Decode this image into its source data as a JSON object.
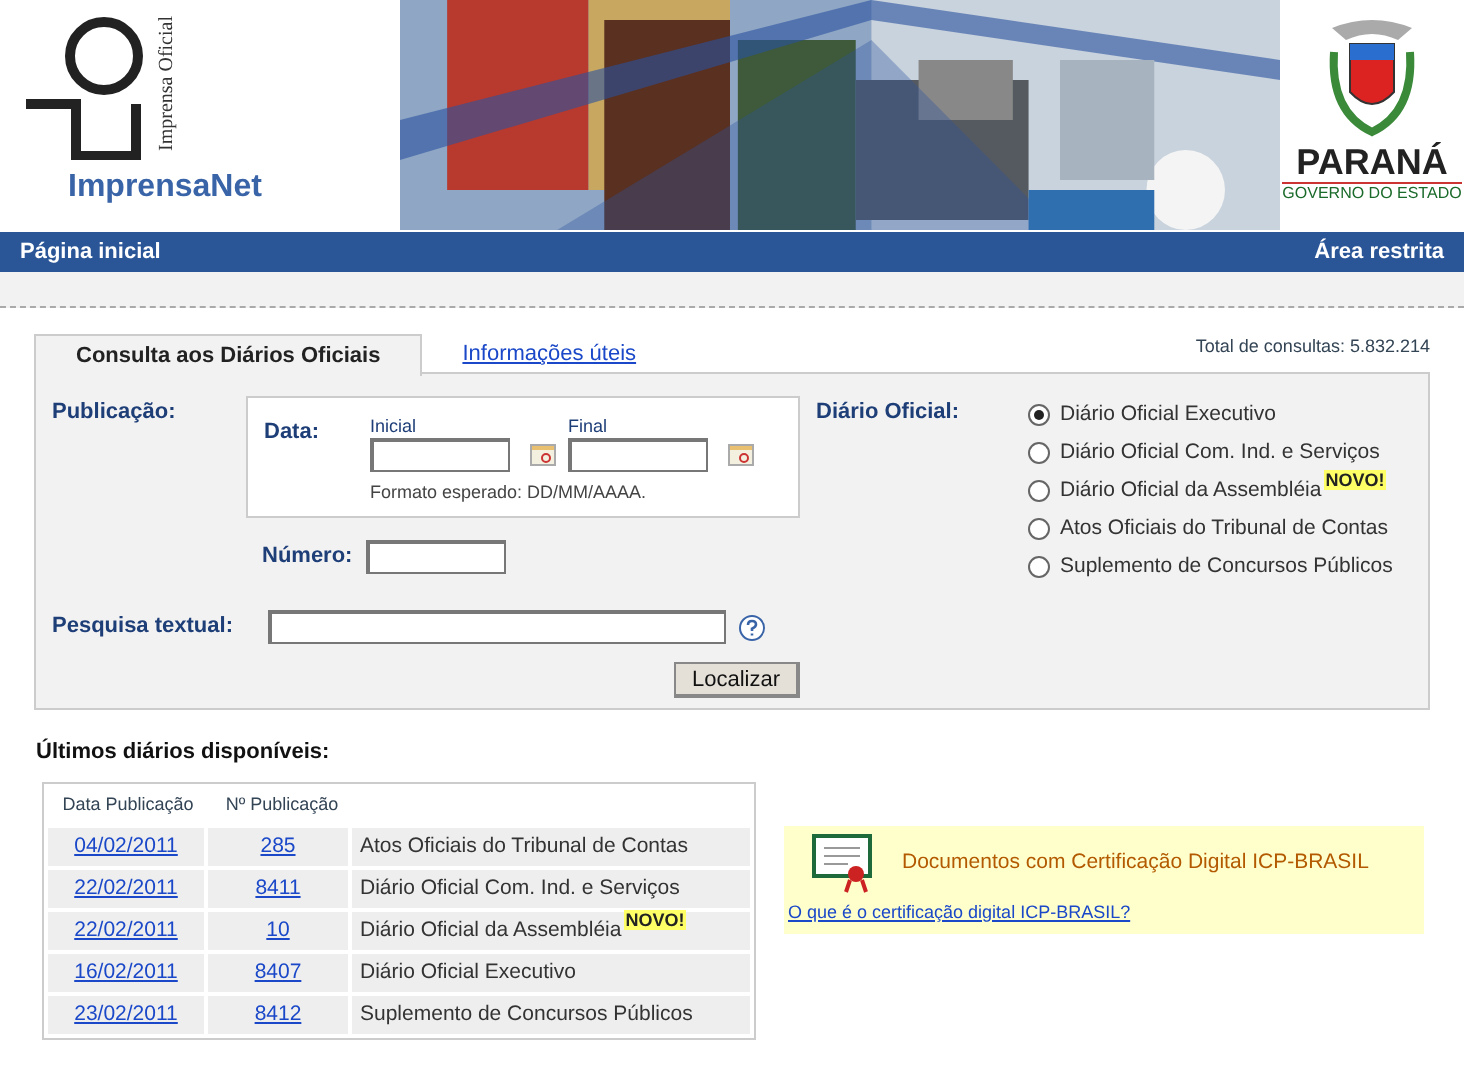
{
  "header": {
    "org_label": "Imprensa Oficial",
    "site_name": "ImprensaNet",
    "state_name": "PARANÁ",
    "state_subtitle": "GOVERNO DO ESTADO"
  },
  "nav": {
    "left": "Página inicial",
    "right": "Área restrita"
  },
  "tabs": [
    {
      "label": "Consulta aos Diários Oficiais",
      "selected": true
    },
    {
      "label": "Informações úteis",
      "selected": false
    }
  ],
  "total": "Total de consultas: 5.832.214",
  "form": {
    "publicacao_label": "Publicação:",
    "data_label": "Data:",
    "inicial_label": "Inicial",
    "final_label": "Final",
    "format_hint": "Formato esperado: DD/MM/AAAA.",
    "numero_label": "Número:",
    "pesquisa_label": "Pesquisa textual:",
    "search_button": "Localizar",
    "diario_label": "Diário Oficial:",
    "options": [
      {
        "label": "Diário Oficial Executivo",
        "selected": true
      },
      {
        "label": "Diário Oficial Com. Ind. e Serviços",
        "selected": false
      },
      {
        "label": "Diário Oficial da Assembléia",
        "badge": "NOVO!",
        "selected": false
      },
      {
        "label": "Atos Oficiais do Tribunal de Contas",
        "selected": false
      },
      {
        "label": "Suplemento de Concursos Públicos",
        "selected": false
      }
    ]
  },
  "latest": {
    "title": "Últimos diários disponíveis:",
    "columns": [
      "Data Publicação",
      "Nº Publicação"
    ],
    "rows": [
      {
        "date": "04/02/2011",
        "number": "285",
        "title": "Atos Oficiais do Tribunal de Contas"
      },
      {
        "date": "22/02/2011",
        "number": "8411",
        "title": "Diário Oficial Com. Ind. e Serviços"
      },
      {
        "date": "22/02/2011",
        "number": "10",
        "title": "Diário Oficial da Assembléia",
        "badge": "NOVO!"
      },
      {
        "date": "16/02/2011",
        "number": "8407",
        "title": "Diário Oficial Executivo"
      },
      {
        "date": "23/02/2011",
        "number": "8412",
        "title": "Suplemento de Concursos Públicos"
      }
    ]
  },
  "cert": {
    "title": "Documentos com Certificação Digital ICP-BRASIL",
    "link": "O que é o certificação digital ICP-BRASIL?"
  }
}
